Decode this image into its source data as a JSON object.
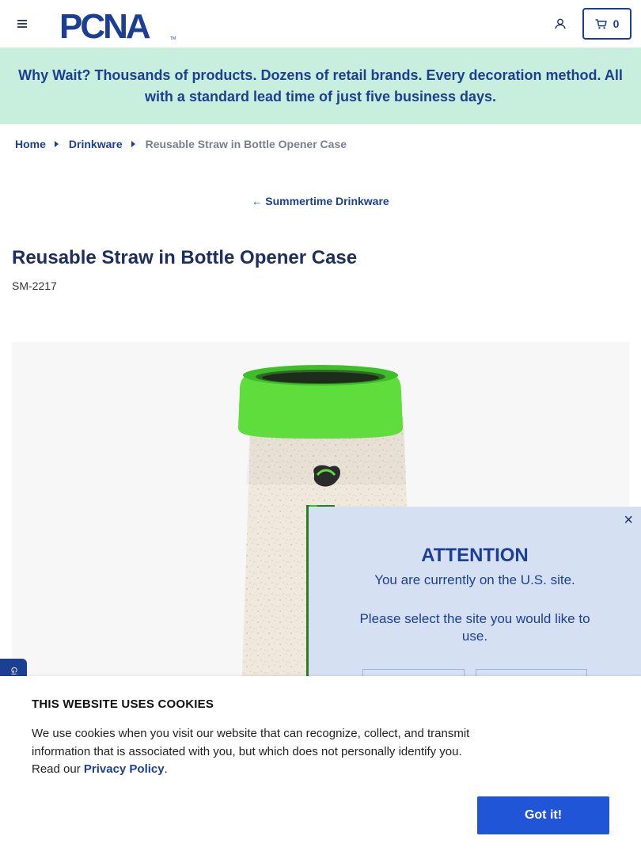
{
  "header": {
    "logo_text": "PCNA",
    "logo_tm": "TM",
    "cart_count": "0",
    "icons": {
      "menu": "hamburger-icon",
      "account": "user-icon",
      "cart": "cart-icon"
    }
  },
  "banner": {
    "text": "Why Wait? Thousands of products. Dozens of retail brands. Every decoration method. All with a standard lead time of just five business days."
  },
  "breadcrumb": {
    "items": [
      "Home",
      "Drinkware"
    ],
    "current": "Reusable Straw in Bottle Opener Case"
  },
  "back_link": {
    "label": "Summertime Drinkware"
  },
  "product": {
    "title": "Reusable Straw in Bottle Opener Case",
    "sku": "SM-2217"
  },
  "side_tab": {
    "label": "Gi"
  },
  "region_popup": {
    "title": "ATTENTION",
    "line1": "You are currently on the U.S. site.",
    "line2": "Please select the site you would like to use."
  },
  "cookie_banner": {
    "title": "THIS WEBSITE USES COOKIES",
    "text_before": "We use cookies when you visit our website that can recognize, collect, and transmit information that is associated with you, but which does not personally identify you. Read our ",
    "link": "Privacy Policy",
    "text_after": ".",
    "button": "Got it!"
  },
  "colors": {
    "brand_blue": "#1c3f94",
    "banner_bg": "#c8eedd",
    "popup_bg": "#d5e0f3",
    "cookie_button": "#2155d8",
    "product_lid": "#5fdd3c"
  }
}
